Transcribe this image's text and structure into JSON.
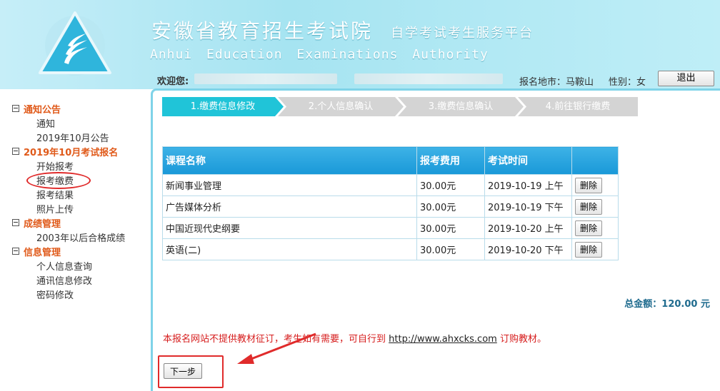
{
  "header": {
    "title": "安徽省教育招生考试院",
    "subtitle": "自学考试考生服务平台",
    "title_en": "Anhui Education Examinations Authority",
    "welcome_label": "欢迎您:",
    "region": "报名地市：马鞍山",
    "gender": "性别：女",
    "logout": "退出"
  },
  "sidebar": {
    "categories": [
      {
        "label": "通知公告",
        "items": [
          "通知",
          "2019年10月公告"
        ]
      },
      {
        "label": "2019年10月考试报名",
        "items": [
          "开始报考",
          "报考缴费",
          "报考结果",
          "照片上传"
        ]
      },
      {
        "label": "成绩管理",
        "items": [
          "2003年以后合格成绩"
        ]
      },
      {
        "label": "信息管理",
        "items": [
          "个人信息查询",
          "通讯信息修改",
          "密码修改"
        ]
      }
    ]
  },
  "steps": [
    {
      "label": "1.缴费信息修改",
      "active": true
    },
    {
      "label": "2.个人信息确认",
      "active": false
    },
    {
      "label": "3.缴费信息确认",
      "active": false
    },
    {
      "label": "4.前往银行缴费",
      "active": false
    }
  ],
  "table": {
    "headers": [
      "课程名称",
      "报考费用",
      "考试时间",
      ""
    ],
    "rows": [
      {
        "course": "新闻事业管理",
        "fee": "30.00元",
        "time": "2019-10-19 上午",
        "action": "删除"
      },
      {
        "course": "广告媒体分析",
        "fee": "30.00元",
        "time": "2019-10-19 下午",
        "action": "删除"
      },
      {
        "course": "中国近现代史纲要",
        "fee": "30.00元",
        "time": "2019-10-20 上午",
        "action": "删除"
      },
      {
        "course": "英语(二)",
        "fee": "30.00元",
        "time": "2019-10-20 下午",
        "action": "删除"
      }
    ]
  },
  "total": "总金额：120.00 元",
  "notice": {
    "before": "本报名网站不提供教材征订，考生如有需要，可自行到 ",
    "link": "http://www.ahxcks.com",
    "after": " 订购教材。"
  },
  "next_button": "下一步",
  "colors": {
    "header_bg": "#a6e4f1",
    "accent": "#1998d8",
    "active_step": "#20c4d8",
    "category": "#e05a1a",
    "annotation": "#e02b2b"
  }
}
